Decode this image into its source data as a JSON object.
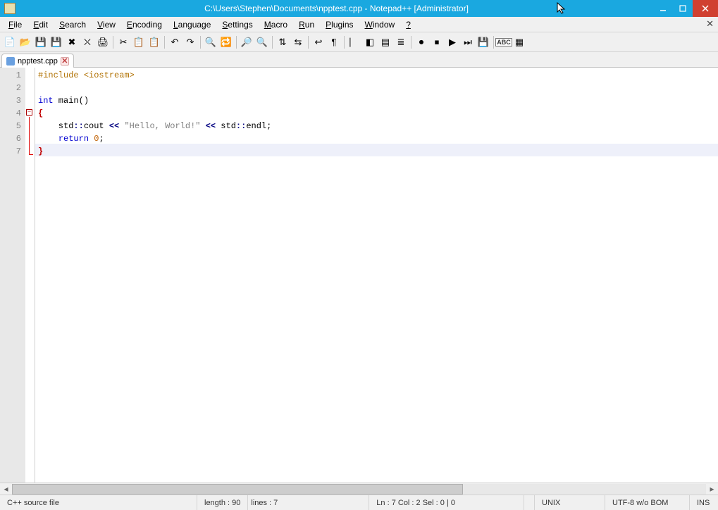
{
  "title": "C:\\Users\\Stephen\\Documents\\npptest.cpp - Notepad++ [Administrator]",
  "menu": [
    "File",
    "Edit",
    "Search",
    "View",
    "Encoding",
    "Language",
    "Settings",
    "Macro",
    "Run",
    "Plugins",
    "Window",
    "?"
  ],
  "tab": {
    "filename": "npptest.cpp"
  },
  "code": {
    "lines": [
      {
        "n": 1,
        "tokens": [
          [
            "pre",
            "#include "
          ],
          [
            "pre",
            "<iostream>"
          ]
        ]
      },
      {
        "n": 2,
        "tokens": [
          [
            "",
            "  "
          ]
        ]
      },
      {
        "n": 3,
        "tokens": [
          [
            "kw",
            "int"
          ],
          [
            "",
            " main"
          ],
          [
            "punct",
            "()"
          ]
        ]
      },
      {
        "n": 4,
        "tokens": [
          [
            "brace",
            "{"
          ]
        ]
      },
      {
        "n": 5,
        "tokens": [
          [
            "",
            "    std"
          ],
          [
            "op",
            "::"
          ],
          [
            "",
            "cout "
          ],
          [
            "op",
            "<<"
          ],
          [
            "",
            " "
          ],
          [
            "str",
            "\"Hello, World!\""
          ],
          [
            "",
            " "
          ],
          [
            "op",
            "<<"
          ],
          [
            "",
            " std"
          ],
          [
            "op",
            "::"
          ],
          [
            "",
            "endl"
          ],
          [
            "punct",
            ";"
          ]
        ]
      },
      {
        "n": 6,
        "tokens": [
          [
            "",
            "    "
          ],
          [
            "kw",
            "return"
          ],
          [
            "",
            " "
          ],
          [
            "num",
            "0"
          ],
          [
            "punct",
            ";"
          ]
        ]
      },
      {
        "n": 7,
        "tokens": [
          [
            "brace",
            "}"
          ]
        ]
      }
    ],
    "current_line": 7
  },
  "status": {
    "filetype": "C++ source file",
    "length": "length : 90",
    "lines": "lines : 7",
    "pos": "Ln : 7    Col : 2    Sel : 0 | 0",
    "eol": "UNIX",
    "encoding": "UTF-8 w/o BOM",
    "mode": "INS"
  },
  "toolbar_icons": [
    {
      "n": "new-file-icon",
      "g": "📄"
    },
    {
      "n": "open-file-icon",
      "g": "📂"
    },
    {
      "n": "save-icon",
      "g": "💾"
    },
    {
      "n": "save-all-icon",
      "g": "💾"
    },
    {
      "n": "close-icon",
      "g": "✖"
    },
    {
      "n": "close-all-icon",
      "g": "⛌"
    },
    {
      "n": "print-icon",
      "g": "🖨"
    },
    {
      "n": "sep"
    },
    {
      "n": "cut-icon",
      "g": "✂"
    },
    {
      "n": "copy-icon",
      "g": "📋"
    },
    {
      "n": "paste-icon",
      "g": "📋"
    },
    {
      "n": "sep"
    },
    {
      "n": "undo-icon",
      "g": "↶"
    },
    {
      "n": "redo-icon",
      "g": "↷"
    },
    {
      "n": "sep"
    },
    {
      "n": "find-icon",
      "g": "🔍"
    },
    {
      "n": "replace-icon",
      "g": "🔁"
    },
    {
      "n": "sep"
    },
    {
      "n": "zoom-in-icon",
      "g": "🔎"
    },
    {
      "n": "zoom-out-icon",
      "g": "🔍"
    },
    {
      "n": "sep"
    },
    {
      "n": "sync-vscroll-icon",
      "g": "⇅"
    },
    {
      "n": "sync-hscroll-icon",
      "g": "⇆"
    },
    {
      "n": "sep"
    },
    {
      "n": "wordwrap-icon",
      "g": "↩"
    },
    {
      "n": "show-all-chars-icon",
      "g": "¶"
    },
    {
      "n": "sep"
    },
    {
      "n": "indent-guide-icon",
      "g": "⎸"
    },
    {
      "n": "user-lang-icon",
      "g": "◧"
    },
    {
      "n": "doc-map-icon",
      "g": "▤"
    },
    {
      "n": "func-list-icon",
      "g": "≣"
    },
    {
      "n": "sep"
    },
    {
      "n": "record-macro-icon",
      "g": "⏺"
    },
    {
      "n": "stop-macro-icon",
      "g": "⏹"
    },
    {
      "n": "play-macro-icon",
      "g": "▶"
    },
    {
      "n": "play-multi-icon",
      "g": "⏭"
    },
    {
      "n": "save-macro-icon",
      "g": "💾"
    },
    {
      "n": "sep"
    },
    {
      "n": "spellcheck-icon",
      "g": "ABC"
    },
    {
      "n": "spellcheck-next-icon",
      "g": "▦"
    }
  ]
}
